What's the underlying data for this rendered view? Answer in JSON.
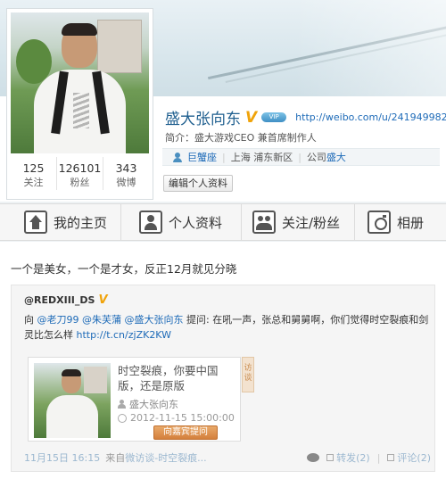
{
  "profile": {
    "name": "盛大张向东",
    "verified_mark": "V",
    "vip_badge": "VIP",
    "url": "http://weibo.com/u/2419499821",
    "bio_label": "简介：",
    "bio": "盛大游戏CEO 兼首席制作人",
    "zodiac": "巨蟹座",
    "location": "上海 浦东新区",
    "company_label": "公司",
    "company": "盛大",
    "edit_button": "编辑个人资料"
  },
  "stats": [
    {
      "num": "125",
      "label": "关注"
    },
    {
      "num": "126101",
      "label": "粉丝"
    },
    {
      "num": "343",
      "label": "微博"
    }
  ],
  "nav": [
    {
      "label": "我的主页",
      "icon": "home-icon"
    },
    {
      "label": "个人资料",
      "icon": "person-icon"
    },
    {
      "label": "关注/粉丝",
      "icon": "people-icon"
    },
    {
      "label": "相册",
      "icon": "camera-icon"
    }
  ],
  "post": {
    "text": "一个是美女，一个是才女，反正12月就见分晓",
    "repost": {
      "user": "@REDXIII_DS",
      "verified_mark": "V",
      "prefix": "向 ",
      "mentions": "@老刀99 @朱芙蒲 @盛大张向东",
      "question": " 提问: 在吼一声，张总和舅舅啊，你们觉得时空裂痕和剑灵比怎么样 ",
      "short_link": "http://t.cn/zjZK2KW",
      "card": {
        "title": "时空裂痕，你要中国版，还是原版",
        "author": "盛大张向东",
        "time": "2012-11-15 15:00:00",
        "button": "向嘉宾提问",
        "side_tag": "访谈"
      },
      "footer": {
        "time": "11月15日 16:15",
        "from": "来自",
        "source": "微访谈-时空裂痕...",
        "forward": "转发(2)",
        "comment": "评论(2)"
      }
    }
  }
}
